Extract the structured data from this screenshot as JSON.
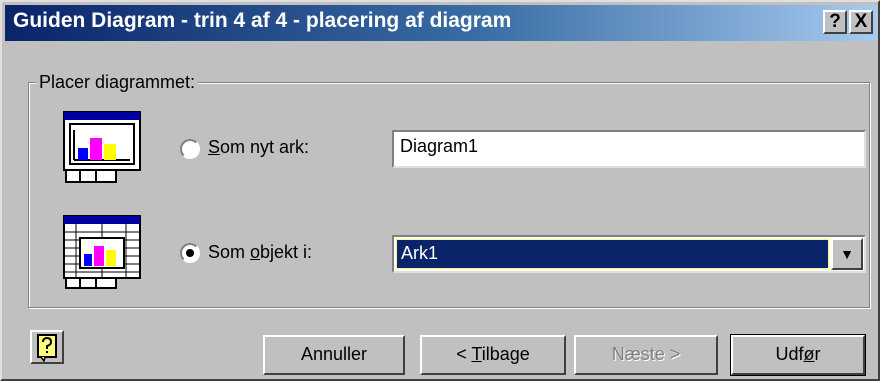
{
  "window": {
    "title": "Guiden Diagram - trin 4 af 4 -  placering af diagram",
    "help_button": "?",
    "close_button": "X"
  },
  "group": {
    "legend": "Placer diagrammet:"
  },
  "option_new_sheet": {
    "label_prefix": "",
    "label_mnemonic": "S",
    "label_rest": "om nyt ark:",
    "selected": false,
    "value": "Diagram1"
  },
  "option_object": {
    "label_prefix": "Som ",
    "label_mnemonic": "o",
    "label_rest": "bjekt i:",
    "selected": true,
    "value": "Ark1"
  },
  "buttons": {
    "cancel": "Annuller",
    "back_prefix": "< ",
    "back_mnemonic": "T",
    "back_rest": "ilbage",
    "next": "Næste >",
    "finish_prefix": "Udf",
    "finish_mnemonic": "ø",
    "finish_rest": "r"
  },
  "colors": {
    "titlebar_start": "#0a246a",
    "titlebar_end": "#a6caf0",
    "selection": "#0a246a",
    "dialog_bg": "#c0c0c0"
  },
  "icons": [
    "chart-sheet-icon",
    "embedded-chart-icon",
    "office-assistant-icon",
    "combo-arrow-icon"
  ]
}
